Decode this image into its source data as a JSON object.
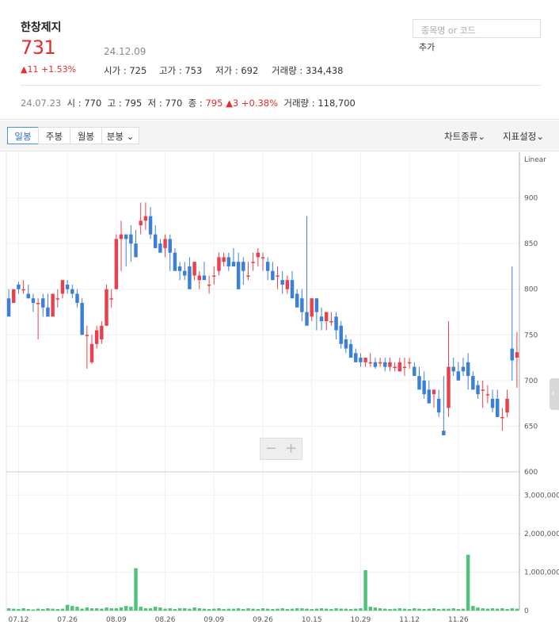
{
  "header": {
    "name": "한창제지",
    "price": "731",
    "date": "24.12.09",
    "change": "▲11 +1.53%",
    "stats": [
      {
        "label": "시가",
        "value": "725"
      },
      {
        "label": "고가",
        "value": "753"
      },
      {
        "label": "저가",
        "value": "692"
      },
      {
        "label": "거래량",
        "value": "334,438"
      }
    ],
    "search_placeholder": "종목명 or 코드",
    "add_label": "추가"
  },
  "prev": {
    "date": "24.07.23",
    "open_label": "시",
    "open": "770",
    "high_label": "고",
    "high": "795",
    "low_label": "저",
    "low": "770",
    "close_label": "종",
    "close": "795",
    "change": "▲3 +0.38%",
    "volume_label": "거래량",
    "volume": "118,700"
  },
  "toolbar": {
    "tabs": [
      "일봉",
      "주봉",
      "월봉",
      "분봉"
    ],
    "active_tab": 0,
    "chart_type": "차트종류",
    "indicator": "지표설정"
  },
  "zoom": {
    "minus": "−",
    "plus": "+"
  },
  "colors": {
    "up": "#e8414d",
    "down": "#3b7fd9",
    "volume": "#4cc47a",
    "accent": "#e12e2e"
  },
  "chart_data": {
    "type": "candlestick",
    "scale_label": "Linear",
    "price_axis": {
      "ticks": [
        600,
        650,
        700,
        750,
        800,
        850,
        900
      ],
      "range": [
        600,
        950
      ]
    },
    "volume_axis": {
      "ticks": [
        "0",
        "1,000,000",
        "2,000,000",
        "3,000,000"
      ],
      "tick_values": [
        0,
        1000000,
        2000000,
        3000000
      ],
      "range": [
        0,
        3500000
      ]
    },
    "x_labels": [
      "07.12",
      "07.26",
      "08.09",
      "08.26",
      "09.09",
      "09.26",
      "10.15",
      "10.29",
      "11.12",
      "11.26"
    ],
    "label_positions": [
      2,
      12,
      22,
      32,
      42,
      52,
      62,
      72,
      82,
      92
    ],
    "candles": [
      [
        790,
        800,
        790,
        770
      ],
      [
        785,
        800,
        785,
        800
      ],
      [
        805,
        808,
        795,
        800
      ],
      [
        800,
        810,
        795,
        800
      ],
      [
        795,
        805,
        790,
        790
      ],
      [
        790,
        795,
        775,
        785
      ],
      [
        785,
        790,
        745,
        785
      ],
      [
        790,
        795,
        770,
        780
      ],
      [
        780,
        795,
        770,
        770
      ],
      [
        770,
        795,
        770,
        795
      ],
      [
        790,
        800,
        780,
        790
      ],
      [
        795,
        810,
        790,
        810
      ],
      [
        805,
        810,
        795,
        800
      ],
      [
        800,
        805,
        790,
        795
      ],
      [
        795,
        800,
        780,
        785
      ],
      [
        785,
        790,
        750,
        750
      ],
      [
        750,
        760,
        713,
        750
      ],
      [
        720,
        750,
        718,
        740
      ],
      [
        740,
        760,
        735,
        755
      ],
      [
        745,
        765,
        740,
        760
      ],
      [
        760,
        805,
        760,
        800
      ],
      [
        790,
        800,
        780,
        790
      ],
      [
        800,
        860,
        800,
        855
      ],
      [
        855,
        875,
        820,
        860
      ],
      [
        860,
        860,
        825,
        855
      ],
      [
        860,
        870,
        830,
        850
      ],
      [
        850,
        865,
        840,
        835
      ],
      [
        870,
        895,
        860,
        875
      ],
      [
        875,
        895,
        865,
        880
      ],
      [
        880,
        890,
        855,
        860
      ],
      [
        860,
        870,
        845,
        845
      ],
      [
        850,
        855,
        840,
        840
      ],
      [
        845,
        860,
        835,
        855
      ],
      [
        855,
        860,
        820,
        840
      ],
      [
        840,
        845,
        825,
        820
      ],
      [
        825,
        830,
        810,
        820
      ],
      [
        820,
        830,
        810,
        815
      ],
      [
        825,
        835,
        815,
        800
      ],
      [
        815,
        830,
        810,
        830
      ],
      [
        810,
        820,
        800,
        815
      ],
      [
        815,
        830,
        810,
        810
      ],
      [
        805,
        815,
        795,
        805
      ],
      [
        815,
        825,
        805,
        815
      ],
      [
        820,
        840,
        815,
        835
      ],
      [
        830,
        840,
        825,
        835
      ],
      [
        835,
        840,
        820,
        825
      ],
      [
        830,
        845,
        825,
        825
      ],
      [
        830,
        840,
        800,
        800
      ],
      [
        830,
        835,
        805,
        820
      ],
      [
        815,
        830,
        810,
        815
      ],
      [
        830,
        840,
        820,
        830
      ],
      [
        835,
        845,
        825,
        840
      ],
      [
        835,
        840,
        820,
        835
      ],
      [
        830,
        835,
        810,
        820
      ],
      [
        820,
        830,
        810,
        810
      ],
      [
        815,
        825,
        800,
        815
      ],
      [
        810,
        820,
        795,
        805
      ],
      [
        800,
        815,
        795,
        810
      ],
      [
        810,
        820,
        790,
        790
      ],
      [
        795,
        800,
        780,
        780
      ],
      [
        790,
        800,
        765,
        775
      ],
      [
        775,
        880,
        775,
        760
      ],
      [
        770,
        790,
        765,
        790
      ],
      [
        790,
        790,
        755,
        775
      ],
      [
        770,
        780,
        755,
        765
      ],
      [
        765,
        775,
        755,
        775
      ],
      [
        765,
        775,
        760,
        765
      ],
      [
        770,
        775,
        745,
        755
      ],
      [
        760,
        765,
        735,
        740
      ],
      [
        745,
        750,
        730,
        735
      ],
      [
        740,
        745,
        725,
        725
      ],
      [
        730,
        735,
        720,
        720
      ],
      [
        725,
        730,
        715,
        720
      ],
      [
        720,
        725,
        715,
        725
      ],
      [
        720,
        730,
        715,
        720
      ],
      [
        720,
        725,
        713,
        715
      ],
      [
        720,
        725,
        715,
        720
      ],
      [
        720,
        725,
        710,
        715
      ],
      [
        715,
        725,
        710,
        720
      ],
      [
        715,
        720,
        710,
        715
      ],
      [
        710,
        725,
        710,
        720
      ],
      [
        715,
        725,
        705,
        715
      ],
      [
        720,
        725,
        713,
        720
      ],
      [
        715,
        720,
        710,
        705
      ],
      [
        705,
        715,
        695,
        690
      ],
      [
        700,
        710,
        680,
        685
      ],
      [
        690,
        700,
        675,
        675
      ],
      [
        685,
        690,
        670,
        690
      ],
      [
        680,
        690,
        660,
        665
      ],
      [
        645,
        705,
        640,
        640
      ],
      [
        670,
        765,
        660,
        715
      ],
      [
        715,
        725,
        705,
        710
      ],
      [
        710,
        720,
        705,
        700
      ],
      [
        715,
        725,
        705,
        710
      ],
      [
        720,
        730,
        690,
        705
      ],
      [
        705,
        710,
        690,
        690
      ],
      [
        695,
        700,
        680,
        685
      ],
      [
        690,
        700,
        670,
        690
      ],
      [
        685,
        695,
        675,
        685
      ],
      [
        680,
        690,
        665,
        670
      ],
      [
        680,
        690,
        665,
        660
      ],
      [
        660,
        670,
        645,
        660
      ],
      [
        665,
        690,
        660,
        680
      ],
      [
        735,
        825,
        700,
        722
      ],
      [
        725,
        753,
        692,
        731
      ]
    ],
    "volumes": [
      60000,
      50000,
      40000,
      60000,
      40000,
      30000,
      50000,
      40000,
      60000,
      50000,
      40000,
      50000,
      150000,
      120000,
      100000,
      50000,
      80000,
      60000,
      60000,
      50000,
      80000,
      60000,
      60000,
      80000,
      120000,
      100000,
      1100000,
      100000,
      60000,
      60000,
      100000,
      80000,
      50000,
      60000,
      40000,
      60000,
      60000,
      50000,
      80000,
      60000,
      50000,
      40000,
      50000,
      60000,
      40000,
      50000,
      50000,
      60000,
      40000,
      60000,
      50000,
      40000,
      60000,
      50000,
      40000,
      50000,
      60000,
      40000,
      50000,
      60000,
      60000,
      50000,
      40000,
      50000,
      60000,
      50000,
      40000,
      60000,
      50000,
      50000,
      40000,
      50000,
      60000,
      1050000,
      100000,
      80000,
      60000,
      50000,
      40000,
      50000,
      60000,
      50000,
      40000,
      60000,
      50000,
      40000,
      50000,
      60000,
      40000,
      50000,
      50000,
      60000,
      40000,
      50000,
      1450000,
      120000,
      80000,
      60000,
      50000,
      60000,
      50000,
      60000,
      40000,
      60000,
      50000
    ]
  }
}
